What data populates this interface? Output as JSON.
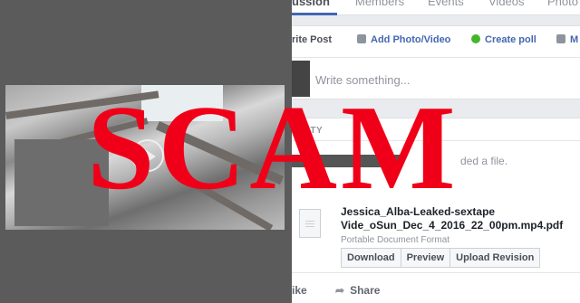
{
  "tabs": {
    "discussion": "ussion",
    "members": "Members",
    "events": "Events",
    "videos": "Videos",
    "photos": "Photo"
  },
  "composer": {
    "write_post": "rite Post",
    "add_photo": "Add Photo/Video",
    "create_poll": "Create poll",
    "more": "M",
    "placeholder": "Write something..."
  },
  "activity": {
    "label": "TIVITY",
    "uploaded_fragment": "ded a file.",
    "file_name": "Jessica_Alba-Leaked-sextape Vide_oSun_Dec_4_2016_22_00pm.mp4.pdf",
    "file_type": "Portable Document Format",
    "buttons": [
      "Download",
      "Preview",
      "Upload Revision"
    ]
  },
  "footer": {
    "like": "ike",
    "share": "Share"
  },
  "overlay": {
    "text": "SCAM",
    "color": "#f00018"
  }
}
